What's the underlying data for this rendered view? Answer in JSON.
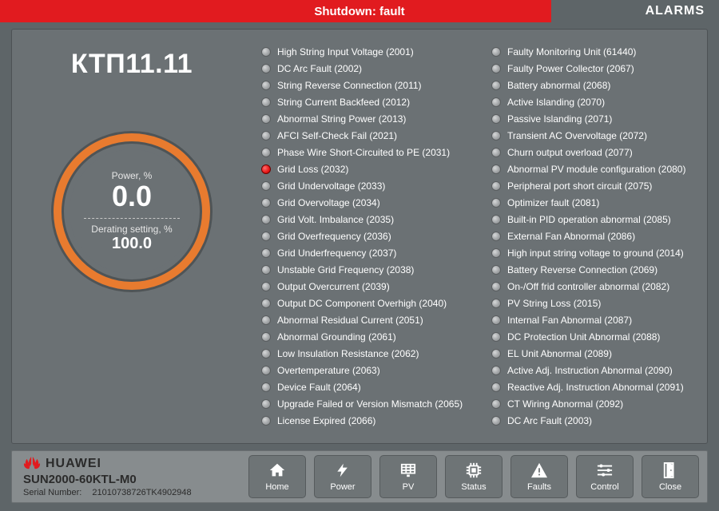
{
  "status_text": "Shutdown: fault",
  "alarms_title": "ALARMS",
  "device_name": "КТП11.11",
  "gauge": {
    "power_label": "Power, %",
    "power_value": "0.0",
    "derating_label": "Derating setting, %",
    "derating_value": "100.0"
  },
  "alarms_col1": [
    {
      "label": "High String Input Voltage (2001)",
      "active": false
    },
    {
      "label": "DC Arc Fault (2002)",
      "active": false
    },
    {
      "label": "String Reverse Connection (2011)",
      "active": false
    },
    {
      "label": "String Current Backfeed (2012)",
      "active": false
    },
    {
      "label": "Abnormal String Power (2013)",
      "active": false
    },
    {
      "label": "AFCI Self-Check Fail (2021)",
      "active": false
    },
    {
      "label": "Phase Wire Short-Circuited to PE (2031)",
      "active": false
    },
    {
      "label": "Grid Loss (2032)",
      "active": true
    },
    {
      "label": "Grid Undervoltage (2033)",
      "active": false
    },
    {
      "label": "Grid Overvoltage (2034)",
      "active": false
    },
    {
      "label": "Grid Volt. Imbalance (2035)",
      "active": false
    },
    {
      "label": "Grid Overfrequency (2036)",
      "active": false
    },
    {
      "label": "Grid Underfrequency (2037)",
      "active": false
    },
    {
      "label": "Unstable Grid Frequency (2038)",
      "active": false
    },
    {
      "label": "Output Overcurrent (2039)",
      "active": false
    },
    {
      "label": "Output DC Component Overhigh (2040)",
      "active": false
    },
    {
      "label": "Abnormal Residual Current (2051)",
      "active": false
    },
    {
      "label": "Abnormal Grounding (2061)",
      "active": false
    },
    {
      "label": "Low Insulation Resistance (2062)",
      "active": false
    },
    {
      "label": "Overtemperature (2063)",
      "active": false
    },
    {
      "label": "Device Fault (2064)",
      "active": false
    },
    {
      "label": "Upgrade Failed or Version Mismatch (2065)",
      "active": false
    },
    {
      "label": "License Expired (2066)",
      "active": false
    }
  ],
  "alarms_col2": [
    {
      "label": "Faulty Monitoring Unit (61440)",
      "active": false
    },
    {
      "label": "Faulty Power Collector (2067)",
      "active": false
    },
    {
      "label": "Battery abnormal (2068)",
      "active": false
    },
    {
      "label": "Active Islanding (2070)",
      "active": false
    },
    {
      "label": "Passive Islanding (2071)",
      "active": false
    },
    {
      "label": "Transient AC Overvoltage (2072)",
      "active": false
    },
    {
      "label": "Churn output overload (2077)",
      "active": false
    },
    {
      "label": "Abnormal PV module configuration (2080)",
      "active": false
    },
    {
      "label": "Peripheral port short circuit (2075)",
      "active": false
    },
    {
      "label": "Optimizer fault (2081)",
      "active": false
    },
    {
      "label": "Built-in PID operation abnormal (2085)",
      "active": false
    },
    {
      "label": "External Fan Abnormal (2086)",
      "active": false
    },
    {
      "label": "High input string voltage to ground (2014)",
      "active": false
    },
    {
      "label": "Battery Reverse Connection (2069)",
      "active": false
    },
    {
      "label": "On-/Off frid controller abnormal (2082)",
      "active": false
    },
    {
      "label": "PV String Loss (2015)",
      "active": false
    },
    {
      "label": "Internal Fan Abnormal (2087)",
      "active": false
    },
    {
      "label": "DC Protection Unit Abnormal (2088)",
      "active": false
    },
    {
      "label": "EL Unit Abnormal (2089)",
      "active": false
    },
    {
      "label": "Active Adj. Instruction Abnormal (2090)",
      "active": false
    },
    {
      "label": "Reactive Adj. Instruction Abnormal (2091)",
      "active": false
    },
    {
      "label": "CT Wiring Abnormal (2092)",
      "active": false
    },
    {
      "label": "DC Arc Fault (2003)",
      "active": false
    }
  ],
  "brand": {
    "name": "HUAWEI",
    "model": "SUN2000-60KTL-M0",
    "serial_label": "Serial Number:",
    "serial_value": "21010738726TK4902948"
  },
  "toolbar": {
    "home": "Home",
    "power": "Power",
    "pv": "PV",
    "status": "Status",
    "faults": "Faults",
    "control": "Control",
    "close": "Close"
  }
}
